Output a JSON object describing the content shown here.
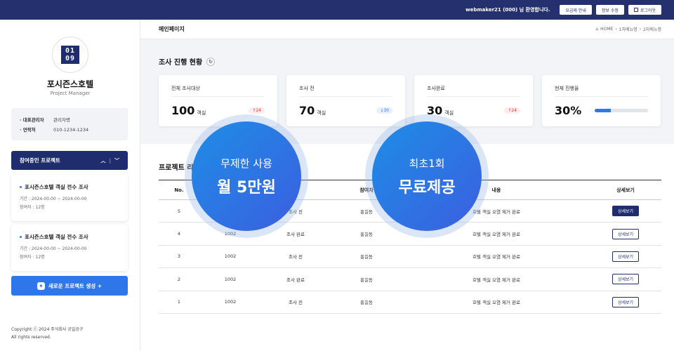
{
  "topbar": {
    "welcome": "webmaker21 (000) 님 환영합니다.",
    "buttons": [
      "요금제 안내",
      "정보 수정",
      "로그아웃"
    ]
  },
  "sidebar": {
    "logo_text": [
      "01",
      "09"
    ],
    "org_name": "포시즌스호텔",
    "org_role": "Project Manager",
    "info": [
      {
        "k": "· 대표관리자",
        "v": "관리자명"
      },
      {
        "k": "· 연락처",
        "v": "010-1234-1234"
      }
    ],
    "project_header": "참여중인 프로젝트",
    "projects": [
      {
        "title": "포시즌스호텔 객실 전수 조사",
        "period": "기간 : 2024-00-00 ~ 2024-00-00",
        "people": "참여자 : 12명"
      },
      {
        "title": "포시즌스호텔 객실 전수 조사",
        "period": "기간 : 2024-00-00 ~ 2024-00-00",
        "people": "참여자 : 12명"
      }
    ],
    "new_project": "새로운 프로젝트 생성 +",
    "copyright": [
      "Copyright ⓒ 2024 주식회사 공일공구",
      "All rights reserved."
    ]
  },
  "header": {
    "page_title": "메인페이지",
    "breadcrumb": [
      "HOME",
      "1차메뉴명",
      "2차메뉴명"
    ]
  },
  "status": {
    "title": "조사 진행 현황",
    "cards": [
      {
        "label": "전체 조사대상",
        "num": "100",
        "unit": "객실",
        "badge": "↑24",
        "dir": "up"
      },
      {
        "label": "조사 전",
        "num": "70",
        "unit": "객실",
        "badge": "↓30",
        "dir": "down"
      },
      {
        "label": "조사완료",
        "num": "30",
        "unit": "객실",
        "badge": "↑24",
        "dir": "up"
      },
      {
        "label": "현재 진행율",
        "num": "30%",
        "unit": "",
        "progress": 0.3
      }
    ]
  },
  "list": {
    "title": "프로젝트 리",
    "columns": [
      "No.",
      "",
      "",
      "참여자",
      "내용",
      "상세보기"
    ],
    "rows": [
      {
        "no": "5",
        "code": "",
        "state": "조사 전",
        "person": "홍길동",
        "content": "호텔 객실 오염 제거 완료",
        "btn": "상세보기"
      },
      {
        "no": "4",
        "code": "1002",
        "state": "조사 완료",
        "person": "홍길동",
        "content": "호텔 객실 오염 제거 완료",
        "btn": "상세보기"
      },
      {
        "no": "3",
        "code": "1002",
        "state": "조사 전",
        "person": "홍길동",
        "content": "호텔 객실 오염 제거 완료",
        "btn": "상세보기"
      },
      {
        "no": "2",
        "code": "1002",
        "state": "조사 완료",
        "person": "홍길동",
        "content": "호텔 객실 오염 제거 완료",
        "btn": "상세보기"
      },
      {
        "no": "1",
        "code": "1002",
        "state": "조사 전",
        "person": "홍길동",
        "content": "호텔 객실 오염 제거 완료",
        "btn": "상세보기"
      }
    ]
  },
  "promos": [
    {
      "small": "무제한 사용",
      "big": "월 5만원"
    },
    {
      "small": "최초1회",
      "big": "무료제공"
    }
  ],
  "colors": {
    "navy": "#1f2d6e",
    "topbar": "#25306e",
    "accent": "#2f77e8"
  }
}
